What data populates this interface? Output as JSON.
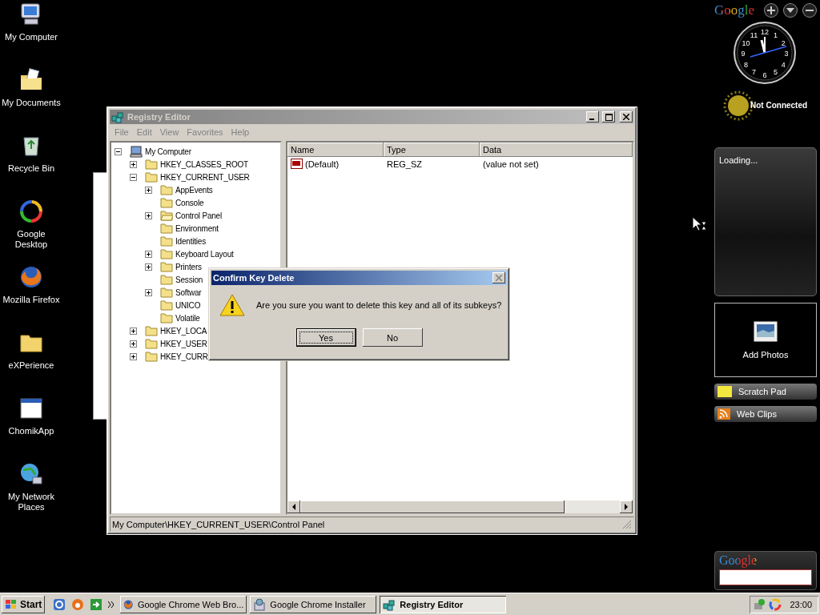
{
  "desktop_icons": [
    {
      "label": "My Computer",
      "kind": "computer"
    },
    {
      "label": "My Documents",
      "kind": "documents"
    },
    {
      "label": "Recycle Bin",
      "kind": "recycle"
    },
    {
      "label": "Google Desktop",
      "kind": "swirl"
    },
    {
      "label": "Mozilla Firefox",
      "kind": "firefox"
    },
    {
      "label": "eXPerience",
      "kind": "folder"
    },
    {
      "label": "ChomikApp",
      "kind": "window"
    },
    {
      "label": "My Network Places",
      "kind": "network"
    }
  ],
  "registry_window": {
    "title": "Registry Editor",
    "menu": [
      "File",
      "Edit",
      "View",
      "Favorites",
      "Help"
    ],
    "tree": [
      {
        "label": "My Computer",
        "kind": "computer",
        "expanded": true,
        "selected": false,
        "children": [
          {
            "label": "HKEY_CLASSES_ROOT",
            "kind": "folder",
            "expanded": false,
            "selected": false
          },
          {
            "label": "HKEY_CURRENT_USER",
            "kind": "folder",
            "expanded": true,
            "selected": false,
            "children": [
              {
                "label": "AppEvents",
                "kind": "folder",
                "expanded": false,
                "selected": false
              },
              {
                "label": "Console",
                "kind": "folder",
                "selected": false
              },
              {
                "label": "Control Panel",
                "kind": "folder",
                "expanded": false,
                "selected": true
              },
              {
                "label": "Environment",
                "kind": "folder",
                "selected": false
              },
              {
                "label": "Identities",
                "kind": "folder",
                "selected": false
              },
              {
                "label": "Keyboard Layout",
                "kind": "folder",
                "expanded": false,
                "selected": false
              },
              {
                "label": "Printers",
                "kind": "folder",
                "expanded": false,
                "selected": false
              },
              {
                "label": "Session",
                "kind": "folder",
                "selected": false
              },
              {
                "label": "Softwar",
                "kind": "folder",
                "expanded": false,
                "selected": false
              },
              {
                "label": "UNICO",
                "kind": "folder",
                "selected": false
              },
              {
                "label": "Volatile",
                "kind": "folder",
                "selected": false
              }
            ]
          },
          {
            "label": "HKEY_LOCA",
            "kind": "folder",
            "expanded": false,
            "selected": false
          },
          {
            "label": "HKEY_USER",
            "kind": "folder",
            "expanded": false,
            "selected": false
          },
          {
            "label": "HKEY_CURR",
            "kind": "folder",
            "expanded": false,
            "selected": false
          }
        ]
      }
    ],
    "columns": [
      "Name",
      "Type",
      "Data"
    ],
    "rows": [
      {
        "name": "(Default)",
        "type": "REG_SZ",
        "data": "(value not set)"
      }
    ],
    "status_bar": "My Computer\\HKEY_CURRENT_USER\\Control Panel"
  },
  "dialog": {
    "title": "Confirm Key Delete",
    "message": "Are you sure you want to delete this key and all of its subkeys?",
    "buttons": [
      {
        "label": "Yes",
        "focused": true
      },
      {
        "label": "No",
        "focused": false
      }
    ]
  },
  "gadgets": {
    "logo": "Google",
    "dial": [
      "12",
      "11",
      "1",
      "10",
      "2",
      "9",
      "3",
      "8",
      "4",
      "7",
      "5",
      "6"
    ],
    "status": "Not Connected",
    "news_panel": "Loading...",
    "photos_panel": "Add Photos",
    "links": [
      {
        "label": "Scratch Pad",
        "kind": "note"
      },
      {
        "label": "Web Clips",
        "kind": "feed"
      }
    ],
    "search_logo": "Google"
  },
  "taskbar": {
    "start": "Start",
    "tasks": [
      {
        "label": "Google Chrome Web Bro...",
        "kind": "firefox",
        "selected": false
      },
      {
        "label": "Google Chrome Installer",
        "kind": "installer",
        "selected": false
      },
      {
        "label": "Registry Editor",
        "kind": "registry",
        "selected": true
      }
    ],
    "clock": "23:00"
  }
}
